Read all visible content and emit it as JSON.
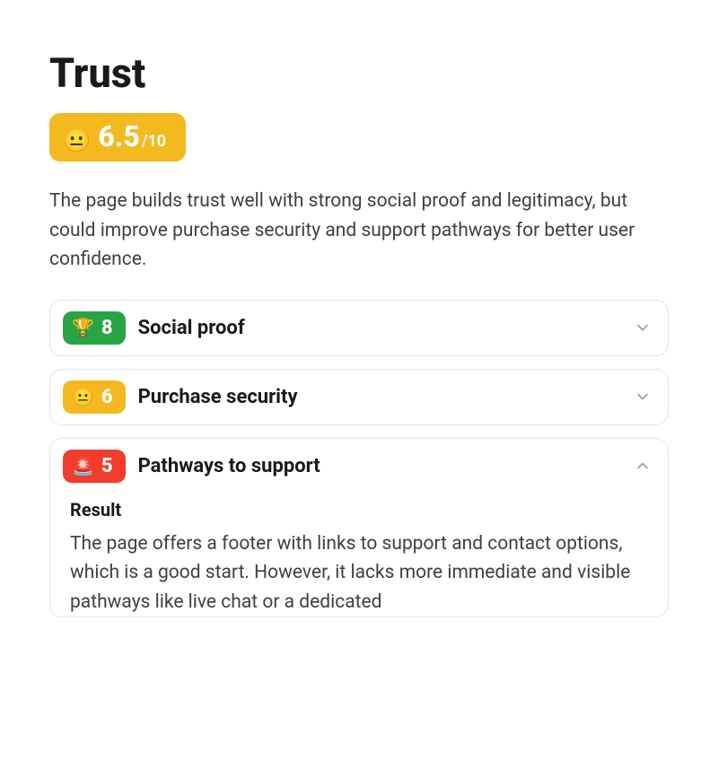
{
  "title": "Trust",
  "overall": {
    "emoji": "😐",
    "value": "6.5",
    "max": "/10"
  },
  "description": "The page builds trust well with strong social proof and legitimacy, but could improve purchase security and support pathways for better user confidence.",
  "colors": {
    "green": "#27a544",
    "amber": "#f4b91f",
    "red": "#f23c2e"
  },
  "items": [
    {
      "emoji": "🏆",
      "score": "8",
      "label": "Social proof",
      "chip_color": "green",
      "expanded": false
    },
    {
      "emoji": "😐",
      "score": "6",
      "label": "Purchase security",
      "chip_color": "amber",
      "expanded": false
    },
    {
      "emoji": "🚨",
      "score": "5",
      "label": "Pathways to support",
      "chip_color": "red",
      "expanded": true,
      "body": {
        "heading": "Result",
        "text": "The page offers a footer with links to support and contact options, which is a good start. However, it lacks more immediate and visible pathways like live chat or a dedicated"
      }
    }
  ]
}
